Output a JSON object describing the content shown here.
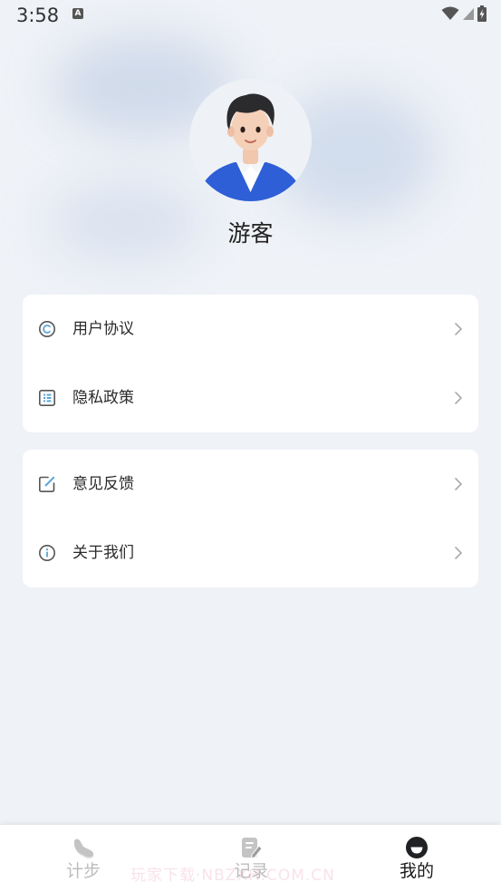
{
  "status_bar": {
    "time": "3:58",
    "notification_badge": "A",
    "icons": [
      "wifi-icon",
      "signal-icon",
      "battery-charging-icon"
    ]
  },
  "profile": {
    "avatar_icon": "person-avatar-icon",
    "name": "游客"
  },
  "menu_groups": [
    {
      "items": [
        {
          "label": "用户协议",
          "icon": "copyright-icon"
        },
        {
          "label": "隐私政策",
          "icon": "list-document-icon"
        }
      ]
    },
    {
      "items": [
        {
          "label": "意见反馈",
          "icon": "edit-square-icon"
        },
        {
          "label": "关于我们",
          "icon": "info-icon"
        }
      ]
    }
  ],
  "tab_bar": {
    "tabs": [
      {
        "label": "计步",
        "icon": "sneaker-icon",
        "active": false
      },
      {
        "label": "记录",
        "icon": "note-edit-icon",
        "active": false
      },
      {
        "label": "我的",
        "icon": "smiley-face-icon",
        "active": true
      }
    ]
  },
  "watermark": "玩家下载·NBZXH.COM.CN",
  "colors": {
    "background": "#eff2f7",
    "card": "#ffffff",
    "icon_blue": "#5aa6d6",
    "icon_gray": "#555555",
    "active_tab": "#1a1a1a",
    "inactive_tab": "#bdbdbd"
  }
}
